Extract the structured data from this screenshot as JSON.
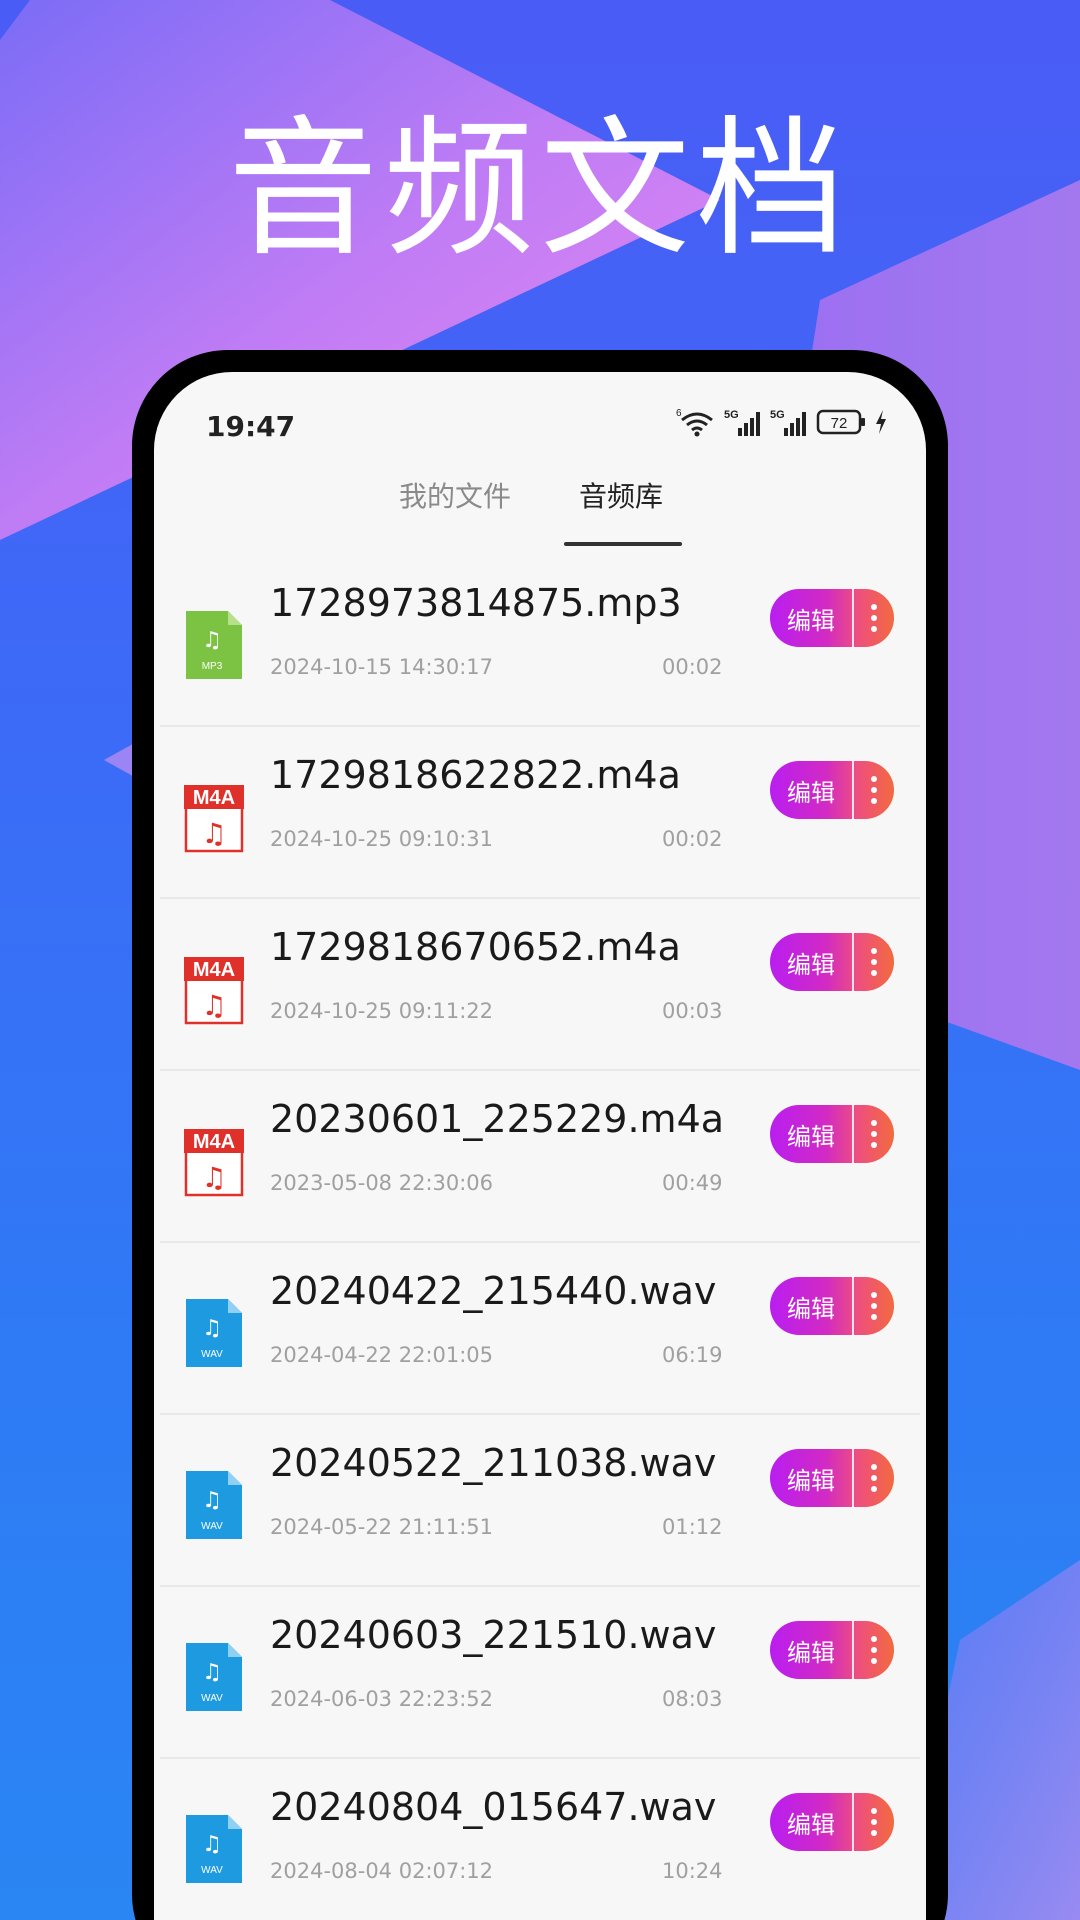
{
  "promo": {
    "headline": "音频文档"
  },
  "status_bar": {
    "time": "19:47",
    "network_1": "5G",
    "network_2": "5G",
    "wifi_label": "6",
    "battery": "72"
  },
  "tabs": [
    {
      "label": "我的文件",
      "active": false
    },
    {
      "label": "音频库",
      "active": true
    }
  ],
  "files": [
    {
      "name": "1728973814875.mp3",
      "date": "2024-10-15 14:30:17",
      "duration": "00:02",
      "type": "mp3",
      "icon": "mp3-file-icon",
      "badge": "MP3",
      "edit_label": "编辑"
    },
    {
      "name": "1729818622822.m4a",
      "date": "2024-10-25 09:10:31",
      "duration": "00:02",
      "type": "m4a",
      "icon": "m4a-file-icon",
      "badge": "M4A",
      "edit_label": "编辑"
    },
    {
      "name": "1729818670652.m4a",
      "date": "2024-10-25 09:11:22",
      "duration": "00:03",
      "type": "m4a",
      "icon": "m4a-file-icon",
      "badge": "M4A",
      "edit_label": "编辑"
    },
    {
      "name": "20230601_225229.m4a",
      "date": "2023-05-08 22:30:06",
      "duration": "00:49",
      "type": "m4a",
      "icon": "m4a-file-icon",
      "badge": "M4A",
      "edit_label": "编辑"
    },
    {
      "name": "20240422_215440.wav",
      "date": "2024-04-22 22:01:05",
      "duration": "06:19",
      "type": "wav",
      "icon": "wav-file-icon",
      "badge": "WAV",
      "edit_label": "编辑"
    },
    {
      "name": "20240522_211038.wav",
      "date": "2024-05-22 21:11:51",
      "duration": "01:12",
      "type": "wav",
      "icon": "wav-file-icon",
      "badge": "WAV",
      "edit_label": "编辑"
    },
    {
      "name": "20240603_221510.wav",
      "date": "2024-06-03 22:23:52",
      "duration": "08:03",
      "type": "wav",
      "icon": "wav-file-icon",
      "badge": "WAV",
      "edit_label": "编辑"
    },
    {
      "name": "20240804_015647.wav",
      "date": "2024-08-04 02:07:12",
      "duration": "10:24",
      "type": "wav",
      "icon": "wav-file-icon",
      "badge": "WAV",
      "edit_label": "编辑"
    }
  ],
  "colors": {
    "mp3": "#7cc243",
    "m4a": "#e0302a",
    "wav": "#1e9be0",
    "pill_start": "#b91ef0",
    "pill_end": "#f26a3e"
  }
}
